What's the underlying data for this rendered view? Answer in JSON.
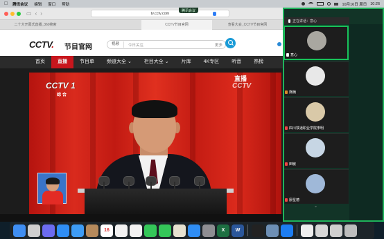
{
  "menubar": {
    "app_name": "腾讯会议",
    "items": [
      "编辑",
      "窗口",
      "帮助"
    ],
    "datetime": "10月16日 周日",
    "time": "10:26"
  },
  "browser": {
    "url": "tv.cctv.com",
    "share_label": "腾讯会议",
    "tabs": [
      "二十大开幕式直播_360搜索",
      "",
      "CCTV节目官网",
      "查看大会_CCTV节目官网"
    ]
  },
  "cctv": {
    "logo": "CCTV",
    "logo_sub": "节目官网",
    "search_category": "视频",
    "search_placeholder": "今日关注",
    "search_more": "更多",
    "nav": [
      {
        "label": "首页",
        "active": false
      },
      {
        "label": "直播",
        "active": true
      },
      {
        "label": "节目单",
        "active": false
      },
      {
        "label": "频道大全 ⌄",
        "active": false
      },
      {
        "label": "栏目大全 ⌄",
        "active": false
      },
      {
        "label": "片库",
        "active": false
      },
      {
        "label": "4K专区",
        "active": false
      },
      {
        "label": "听音",
        "active": false
      },
      {
        "label": "热榜",
        "active": false
      }
    ]
  },
  "video": {
    "channel_logo": "CCTV 1",
    "channel_sub": "综合",
    "watermark": "CCTV",
    "live_label": "直播"
  },
  "meeting": {
    "speaking_label": "正在讲话：意心",
    "participants": [
      {
        "name": "意心",
        "mic": "on",
        "active": true,
        "avatar_color": "#a9a7a0"
      },
      {
        "name": "熊楠",
        "mic": "none",
        "active": false,
        "avatar_color": "#e8e8e8"
      },
      {
        "name": "四川铁道职业学院李明",
        "mic": "off",
        "active": false,
        "avatar_color": "#d9c9a8"
      },
      {
        "name": "田敏",
        "mic": "off",
        "active": false,
        "avatar_color": "#c7d6e4"
      },
      {
        "name": "廖星德",
        "mic": "off",
        "active": false,
        "avatar_color": "#9fb8d8"
      }
    ]
  },
  "dock": {
    "apps": [
      {
        "name": "finder",
        "color": "#3f8ef2",
        "label": ""
      },
      {
        "name": "launchpad",
        "color": "#cfcfcf",
        "label": ""
      },
      {
        "name": "mission-control",
        "color": "#6c6cf0",
        "label": ""
      },
      {
        "name": "safari",
        "color": "#2f8ef5",
        "label": ""
      },
      {
        "name": "mail",
        "color": "#3d9cf5",
        "label": ""
      },
      {
        "name": "contacts",
        "color": "#b58a5c",
        "label": ""
      },
      {
        "name": "calendar",
        "color": "#ffffff",
        "label": "16"
      },
      {
        "name": "reminders",
        "color": "#f2f2f2",
        "label": ""
      },
      {
        "name": "photos",
        "color": "#f2f2f2",
        "label": ""
      },
      {
        "name": "facetime",
        "color": "#34c759",
        "label": ""
      },
      {
        "name": "messages",
        "color": "#34c759",
        "label": ""
      },
      {
        "name": "maps",
        "color": "#e6e1d0",
        "label": ""
      },
      {
        "name": "app-store",
        "color": "#2f8ef5",
        "label": ""
      },
      {
        "name": "system-preferences",
        "color": "#8e8e93",
        "label": ""
      },
      {
        "name": "excel",
        "color": "#1d6f42",
        "label": "X"
      },
      {
        "name": "word",
        "color": "#2b579a",
        "label": "W"
      },
      {
        "name": "qq",
        "color": "#222",
        "label": ""
      },
      {
        "name": "preview",
        "color": "#6d8fb5",
        "label": ""
      },
      {
        "name": "tencent-meeting",
        "color": "#1c7df2",
        "label": ""
      },
      {
        "name": "documents",
        "color": "#eeeeee",
        "label": ""
      },
      {
        "name": "downloads",
        "color": "#d6d6d6",
        "label": ""
      },
      {
        "name": "window-stack",
        "color": "#cfcfcf",
        "label": ""
      },
      {
        "name": "trash",
        "color": "#bdbdbd",
        "label": ""
      }
    ]
  }
}
